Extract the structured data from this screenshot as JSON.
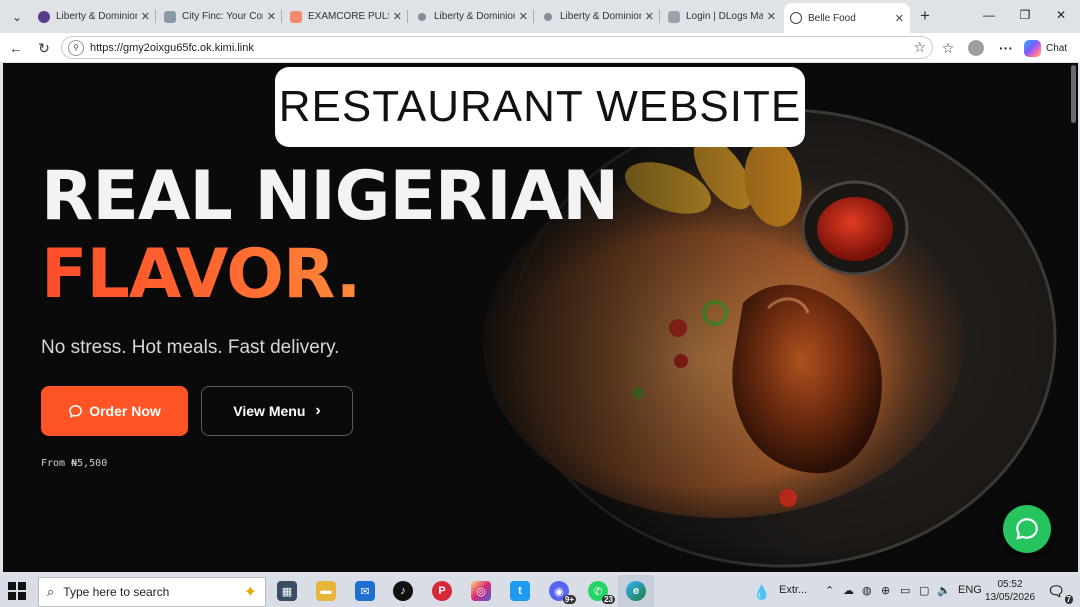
{
  "browser": {
    "tabs": [
      {
        "title": "Liberty & Dominion",
        "favicon_color": "#5a3b8a"
      },
      {
        "title": "City Finc: Your Cont",
        "favicon_color": "#8a98a8"
      },
      {
        "title": "EXAMCORE PULSE",
        "favicon_color": "#f08a6a"
      },
      {
        "title": "Liberty & Dominion",
        "favicon_color": "#8a8a9a"
      },
      {
        "title": "Liberty & Dominion",
        "favicon_color": "#8a8a9a"
      },
      {
        "title": "Login | DLogs Mark",
        "favicon_color": "#9aa3ad"
      },
      {
        "title": "Belle Food",
        "favicon_color": "#2a7ad8",
        "active": true
      }
    ],
    "url": "https://gmy2oixgu65fc.ok.kimi.link",
    "chat_label": "Chat"
  },
  "overlay": {
    "caption": "RESTAURANT WEBSITE"
  },
  "page": {
    "headline_line1": "REAL NIGERIAN",
    "headline_line2": "FLAVOR.",
    "tagline": "No stress. Hot meals. Fast delivery.",
    "order_button": "Order Now",
    "menu_button": "View Menu",
    "price_note": "From ₦5,500",
    "accent_color": "#ff5526",
    "whatsapp_color": "#25c45f"
  },
  "taskbar": {
    "search_placeholder": "Type here to search",
    "tray_weather": "Extr...",
    "language": "ENG",
    "time": "05:52",
    "date": "13/05/2026",
    "whatsapp_badge": "23",
    "discord_badge": "9+",
    "notification_count": "7"
  }
}
